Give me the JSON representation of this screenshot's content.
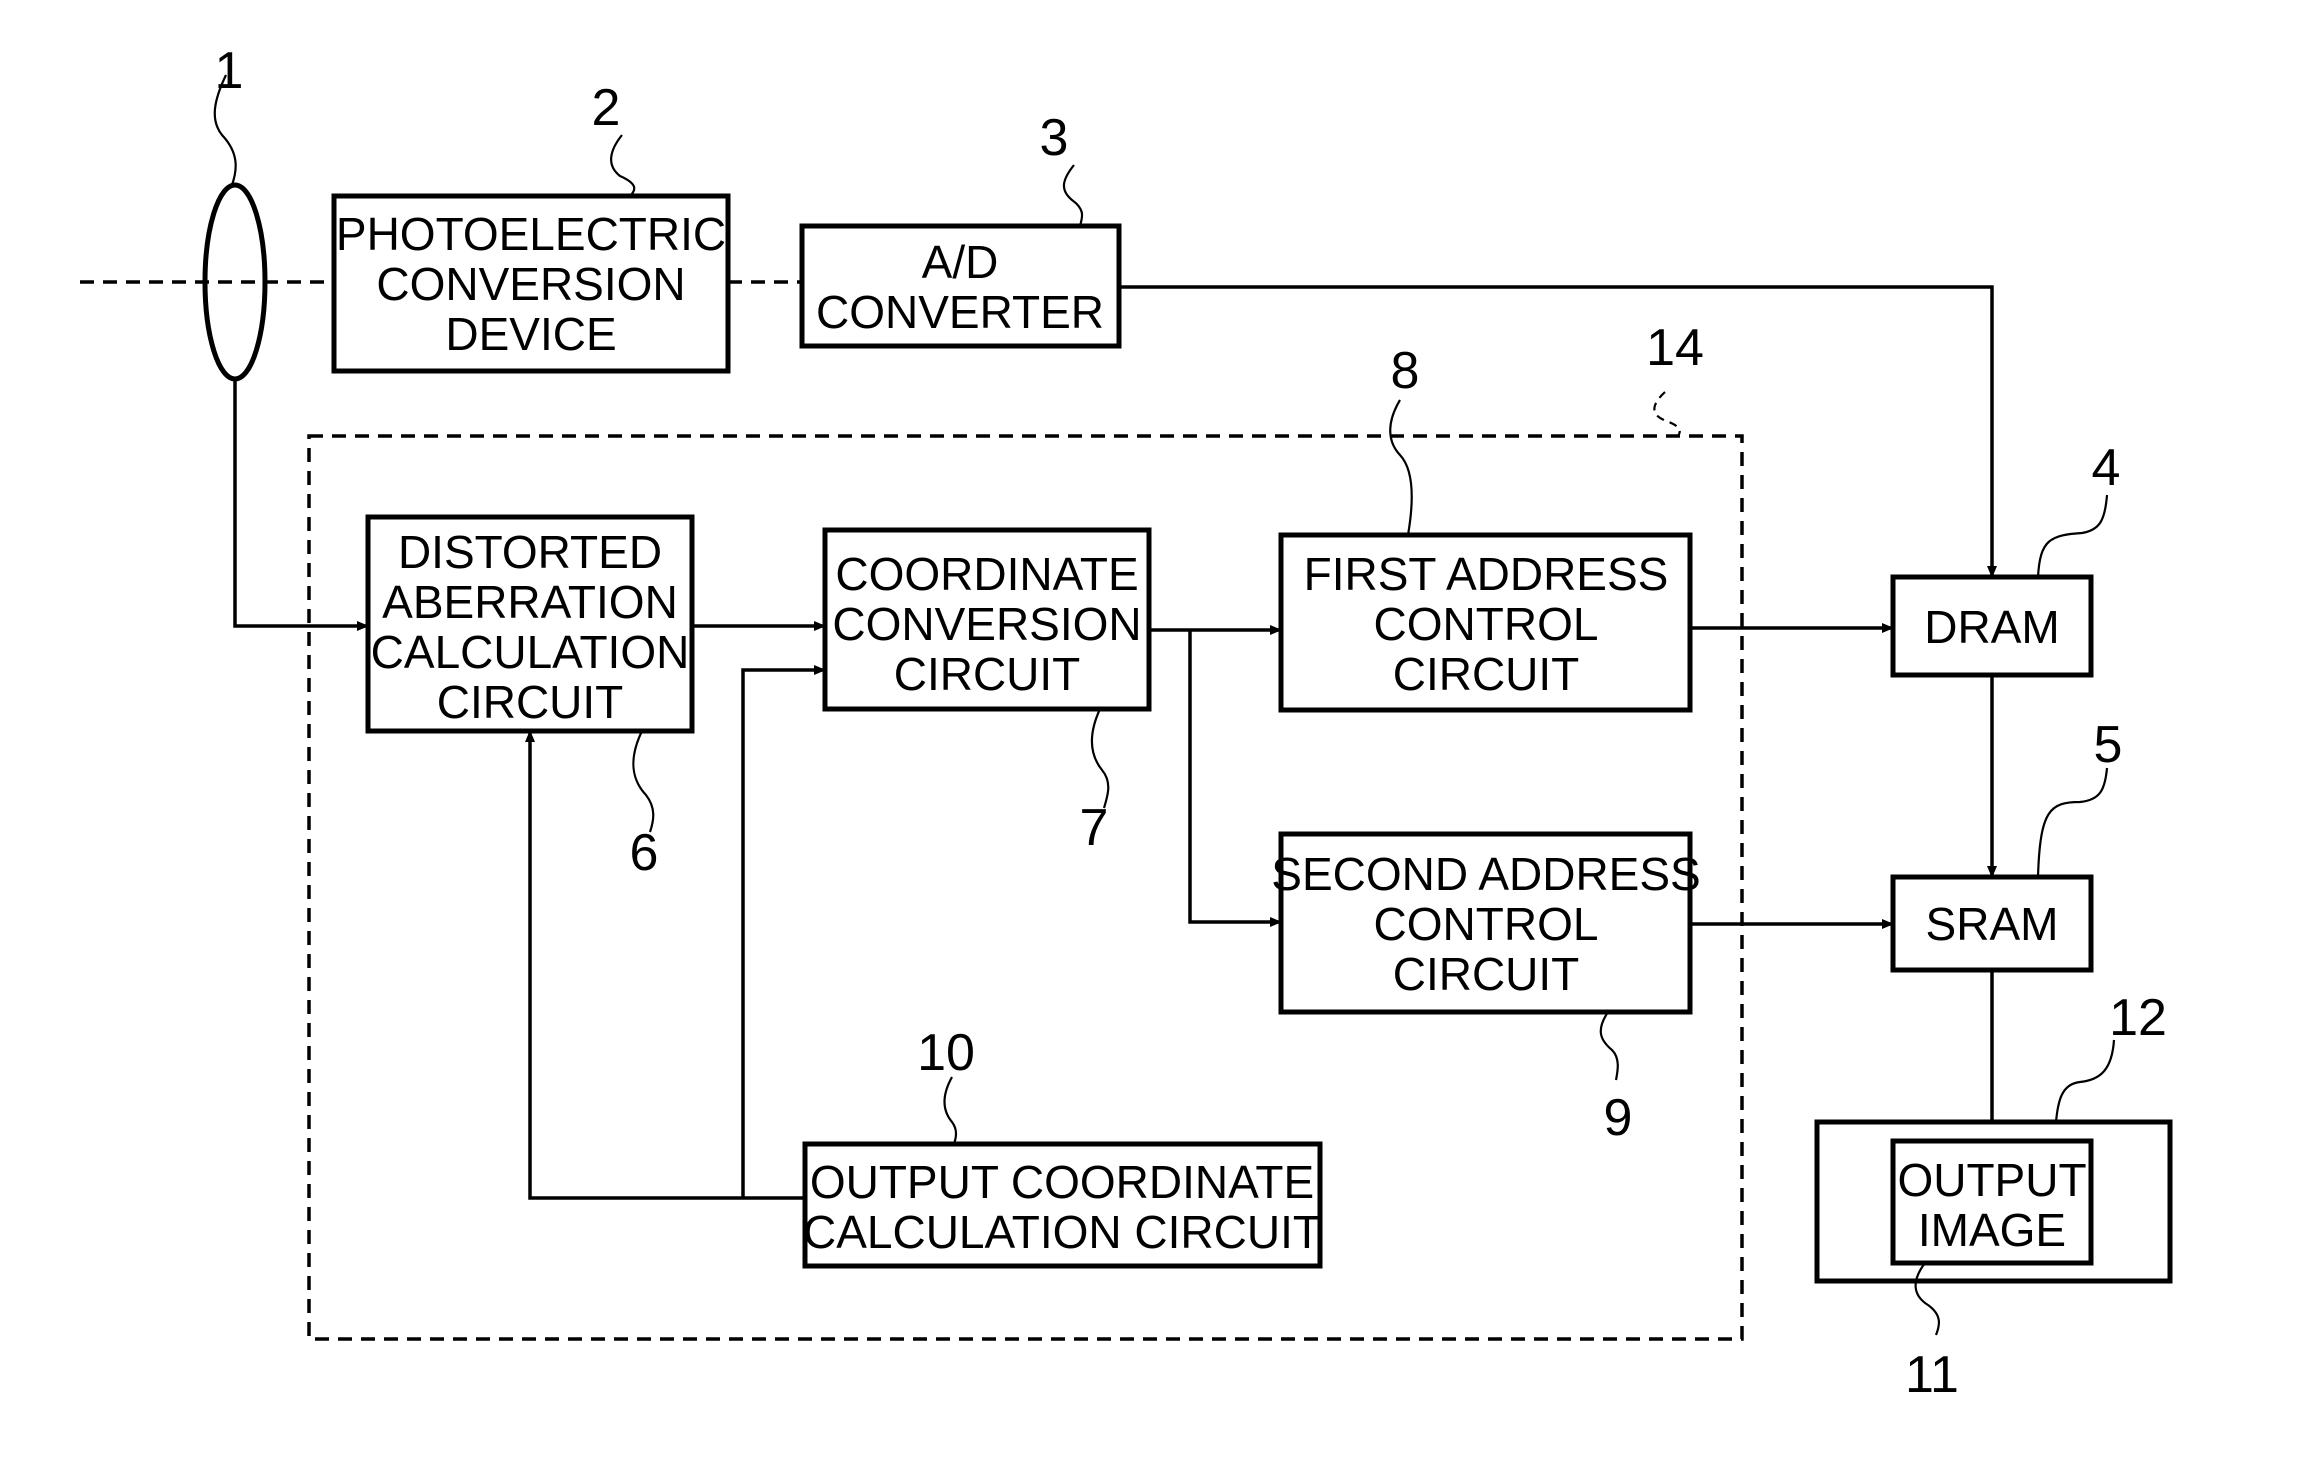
{
  "diagram": {
    "type": "block-diagram",
    "enclosure": {
      "ref": "14",
      "style": "dashed"
    },
    "components": [
      {
        "id": "lens",
        "ref": "1",
        "kind": "lens",
        "lines": []
      },
      {
        "id": "photoelectric",
        "ref": "2",
        "lines": [
          "PHOTOELECTRIC",
          "CONVERSION",
          "DEVICE"
        ]
      },
      {
        "id": "ad",
        "ref": "3",
        "lines": [
          "A/D",
          "CONVERTER"
        ]
      },
      {
        "id": "dram",
        "ref": "4",
        "lines": [
          "DRAM"
        ]
      },
      {
        "id": "sram",
        "ref": "5",
        "lines": [
          "SRAM"
        ]
      },
      {
        "id": "distorted",
        "ref": "6",
        "lines": [
          "DISTORTED",
          "ABERRATION",
          "CALCULATION",
          "CIRCUIT"
        ]
      },
      {
        "id": "coord",
        "ref": "7",
        "lines": [
          "COORDINATE",
          "CONVERSION",
          "CIRCUIT"
        ]
      },
      {
        "id": "first",
        "ref": "8",
        "lines": [
          "FIRST ADDRESS",
          "CONTROL",
          "CIRCUIT"
        ]
      },
      {
        "id": "second",
        "ref": "9",
        "lines": [
          "SECOND ADDRESS",
          "CONTROL",
          "CIRCUIT"
        ]
      },
      {
        "id": "outcoord",
        "ref": "10",
        "lines": [
          "OUTPUT COORDINATE",
          "CALCULATION CIRCUIT"
        ]
      },
      {
        "id": "outimage",
        "ref": "11",
        "lines": [
          "OUTPUT",
          "IMAGE"
        ]
      },
      {
        "id": "display",
        "ref": "12",
        "lines": []
      }
    ],
    "connections": [
      {
        "from": "lens",
        "to": "photoelectric",
        "style": "dashed"
      },
      {
        "from": "photoelectric",
        "to": "ad",
        "style": "dashed"
      },
      {
        "from": "ad",
        "to": "dram",
        "style": "arrow"
      },
      {
        "from": "lens",
        "to": "distorted",
        "style": "arrow"
      },
      {
        "from": "distorted",
        "to": "coord",
        "style": "arrow"
      },
      {
        "from": "outcoord",
        "to": "coord",
        "style": "arrow"
      },
      {
        "from": "outcoord",
        "to": "distorted",
        "style": "arrow"
      },
      {
        "from": "coord",
        "to": "first",
        "style": "arrow"
      },
      {
        "from": "coord",
        "to": "second",
        "style": "arrow"
      },
      {
        "from": "first",
        "to": "dram",
        "style": "arrow"
      },
      {
        "from": "second",
        "to": "sram",
        "style": "arrow"
      },
      {
        "from": "dram",
        "to": "sram",
        "style": "arrow"
      },
      {
        "from": "sram",
        "to": "outimage",
        "style": "arrow"
      }
    ]
  }
}
